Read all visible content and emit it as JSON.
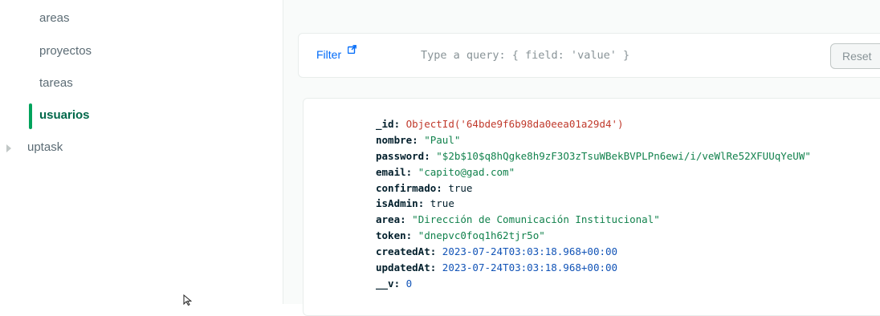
{
  "sidebar": {
    "collections": [
      {
        "label": "areas"
      },
      {
        "label": "proyectos"
      },
      {
        "label": "tareas"
      },
      {
        "label": "usuarios"
      }
    ],
    "active_collection": "usuarios",
    "database": {
      "label": "uptask"
    }
  },
  "query_bar": {
    "filter_label": "Filter",
    "filter_icon": "external-link-icon",
    "placeholder": "Type a query: { field: 'value' }",
    "reset_label": "Reset"
  },
  "document": {
    "fields": [
      {
        "key": "_id",
        "value": "ObjectId('64bde9f6b98da0eea01a29d4')",
        "type": "oid"
      },
      {
        "key": "nombre",
        "value": "\"Paul\"",
        "type": "str"
      },
      {
        "key": "password",
        "value": "\"$2b$10$q8hQgke8h9zF3O3zTsuWBekBVPLPn6ewi/i/veWlRe52XFUUqYeUW\"",
        "type": "str"
      },
      {
        "key": "email",
        "value": "\"capito@gad.com\"",
        "type": "str"
      },
      {
        "key": "confirmado",
        "value": "true",
        "type": "bool"
      },
      {
        "key": "isAdmin",
        "value": "true",
        "type": "bool"
      },
      {
        "key": "area",
        "value": "\"Dirección de Comunicación Institucional\"",
        "type": "str"
      },
      {
        "key": "token",
        "value": "\"dnepvc0foq1h62tjr5o\"",
        "type": "str"
      },
      {
        "key": "createdAt",
        "value": "2023-07-24T03:03:18.968+00:00",
        "type": "date"
      },
      {
        "key": "updatedAt",
        "value": "2023-07-24T03:03:18.968+00:00",
        "type": "date"
      },
      {
        "key": "__v",
        "value": "0",
        "type": "num"
      }
    ]
  },
  "colors": {
    "accent_green": "#00a35c",
    "active_text": "#00684a",
    "filter_link": "#016bf8",
    "objectid_red": "#c0392b",
    "string_green": "#12824d",
    "date_blue": "#1254b7"
  }
}
